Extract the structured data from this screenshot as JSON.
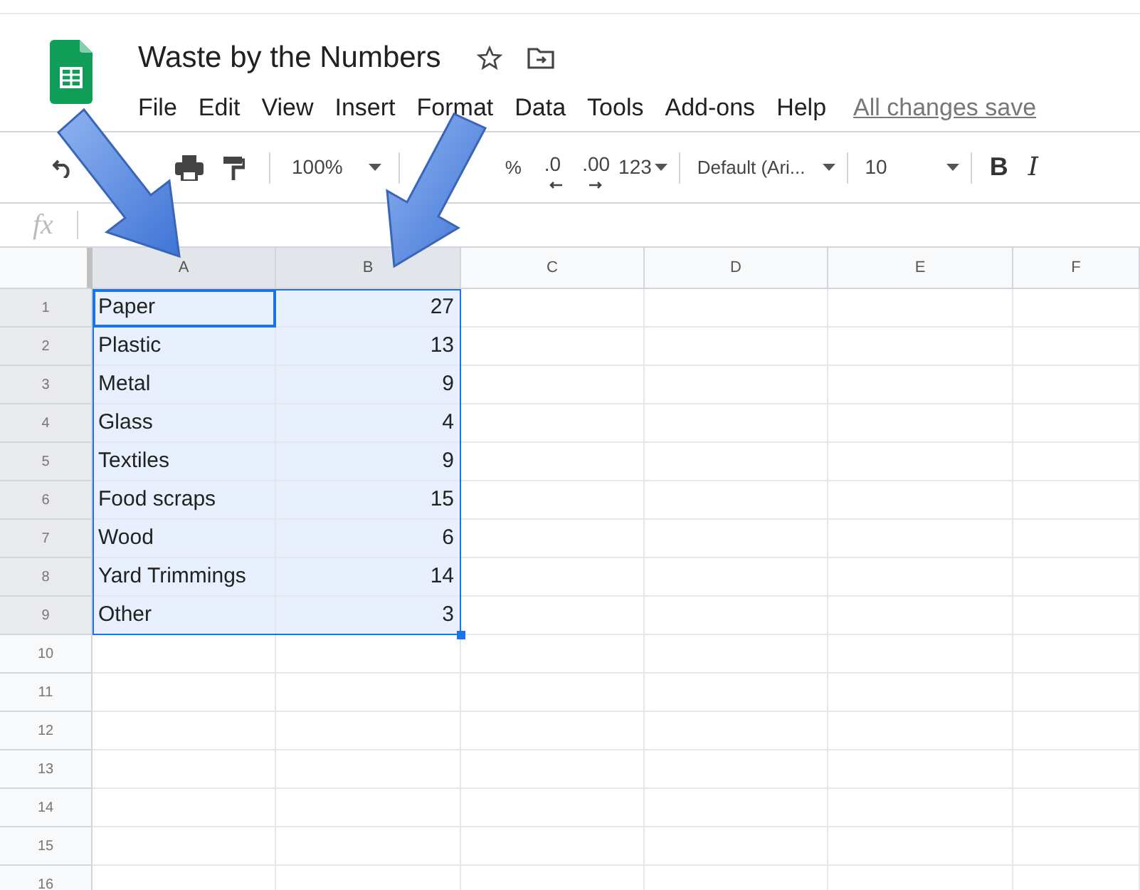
{
  "document": {
    "title": "Waste by the Numbers",
    "save_status": "All changes save"
  },
  "menu": [
    "File",
    "Edit",
    "View",
    "Insert",
    "Format",
    "Data",
    "Tools",
    "Add-ons",
    "Help"
  ],
  "toolbar": {
    "zoom": "100%",
    "percent": "%",
    "decrease_decimals": ".0",
    "increase_decimals": ".00",
    "number_format": "123",
    "font": "Default (Ari...",
    "font_size": "10",
    "bold": "B",
    "italic": "I"
  },
  "formula_bar": {
    "label": "fx"
  },
  "columns": [
    {
      "label": "A",
      "selected": true
    },
    {
      "label": "B",
      "selected": true
    },
    {
      "label": "C",
      "selected": false
    },
    {
      "label": "D",
      "selected": false
    },
    {
      "label": "E",
      "selected": false
    },
    {
      "label": "F",
      "selected": false
    }
  ],
  "rows": [
    {
      "number": "1",
      "selected": true,
      "cells": [
        {
          "text": "Paper",
          "active": true
        },
        {
          "text": "27",
          "active": false
        }
      ]
    },
    {
      "number": "2",
      "selected": true,
      "cells": [
        {
          "text": "Plastic",
          "active": false
        },
        {
          "text": "13",
          "active": false
        }
      ]
    },
    {
      "number": "3",
      "selected": true,
      "cells": [
        {
          "text": "Metal",
          "active": false
        },
        {
          "text": "9",
          "active": false
        }
      ]
    },
    {
      "number": "4",
      "selected": true,
      "cells": [
        {
          "text": "Glass",
          "active": false
        },
        {
          "text": "4",
          "active": false
        }
      ]
    },
    {
      "number": "5",
      "selected": true,
      "cells": [
        {
          "text": "Textiles",
          "active": false
        },
        {
          "text": "9",
          "active": false
        }
      ]
    },
    {
      "number": "6",
      "selected": true,
      "cells": [
        {
          "text": "Food scraps",
          "active": false
        },
        {
          "text": "15",
          "active": false
        }
      ]
    },
    {
      "number": "7",
      "selected": true,
      "cells": [
        {
          "text": "Wood",
          "active": false
        },
        {
          "text": "6",
          "active": false
        }
      ]
    },
    {
      "number": "8",
      "selected": true,
      "cells": [
        {
          "text": "Yard Trimmings",
          "active": false
        },
        {
          "text": "14",
          "active": false
        }
      ]
    },
    {
      "number": "9",
      "selected": true,
      "cells": [
        {
          "text": "Other",
          "active": false
        },
        {
          "text": "3",
          "active": false
        }
      ]
    },
    {
      "number": "10",
      "selected": false
    },
    {
      "number": "11",
      "selected": false
    },
    {
      "number": "12",
      "selected": false
    },
    {
      "number": "13",
      "selected": false
    },
    {
      "number": "14",
      "selected": false
    },
    {
      "number": "15",
      "selected": false
    },
    {
      "number": "16",
      "selected": false
    }
  ]
}
